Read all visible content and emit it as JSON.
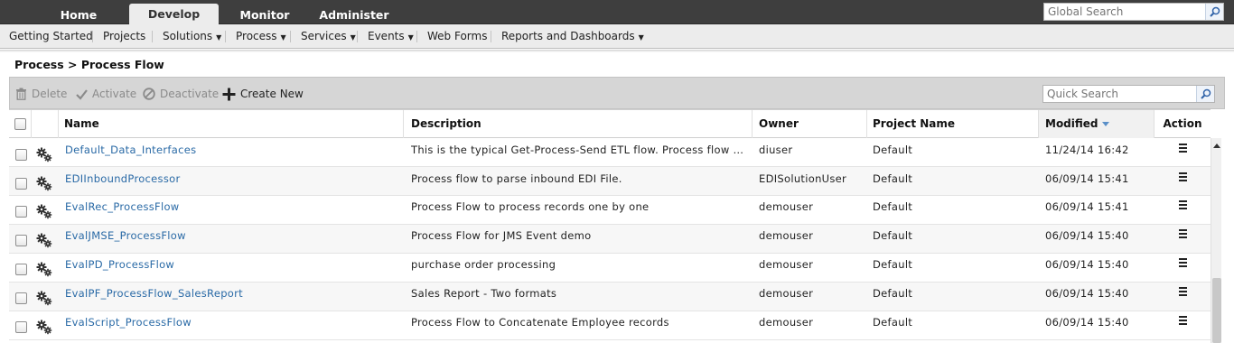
{
  "nav": {
    "tabs": [
      {
        "label": "Home"
      },
      {
        "label": "Develop"
      },
      {
        "label": "Monitor"
      },
      {
        "label": "Administer"
      }
    ],
    "active_tab": "Develop",
    "global_search_placeholder": "Global Search"
  },
  "subnav": {
    "items": [
      {
        "label": "Getting Started",
        "dropdown": false
      },
      {
        "label": "Projects",
        "dropdown": false
      },
      {
        "label": "Solutions",
        "dropdown": true
      },
      {
        "label": "Process",
        "dropdown": true
      },
      {
        "label": "Services",
        "dropdown": true
      },
      {
        "label": "Events",
        "dropdown": true
      },
      {
        "label": "Web Forms",
        "dropdown": false
      },
      {
        "label": "Reports and Dashboards",
        "dropdown": true
      }
    ]
  },
  "breadcrumb": "Process > Process Flow",
  "toolbar": {
    "delete_label": "Delete",
    "activate_label": "Activate",
    "deactivate_label": "Deactivate",
    "create_label": "Create New",
    "quick_search_placeholder": "Quick Search"
  },
  "table": {
    "columns": {
      "name": "Name",
      "description": "Description",
      "owner": "Owner",
      "project": "Project Name",
      "modified": "Modified",
      "action": "Action"
    },
    "sorted_column": "Modified",
    "rows": [
      {
        "name": "Default_Data_Interfaces",
        "description": "This is the typical Get-Process-Send ETL flow. Process flow receive...",
        "owner": "diuser",
        "project": "Default",
        "modified": "11/24/14 16:42"
      },
      {
        "name": "EDIInboundProcessor",
        "description": "Process flow to parse inbound EDI File.",
        "owner": "EDISolutionUser",
        "project": "Default",
        "modified": "06/09/14 15:41"
      },
      {
        "name": "EvalRec_ProcessFlow",
        "description": "Process Flow to process records one by one",
        "owner": "demouser",
        "project": "Default",
        "modified": "06/09/14 15:41"
      },
      {
        "name": "EvalJMSE_ProcessFlow",
        "description": "Process Flow for JMS Event demo",
        "owner": "demouser",
        "project": "Default",
        "modified": "06/09/14 15:40"
      },
      {
        "name": "EvalPD_ProcessFlow",
        "description": "purchase order processing",
        "owner": "demouser",
        "project": "Default",
        "modified": "06/09/14 15:40"
      },
      {
        "name": "EvalPF_ProcessFlow_SalesReport",
        "description": "Sales Report - Two formats",
        "owner": "demouser",
        "project": "Default",
        "modified": "06/09/14 15:40"
      },
      {
        "name": "EvalScript_ProcessFlow",
        "description": "Process Flow to Concatenate Employee records",
        "owner": "demouser",
        "project": "Default",
        "modified": "06/09/14 15:40"
      }
    ]
  },
  "colors": {
    "topbar": "#3e3e3e",
    "link": "#2a6aa6",
    "toolbar": "#d6d6d6"
  }
}
